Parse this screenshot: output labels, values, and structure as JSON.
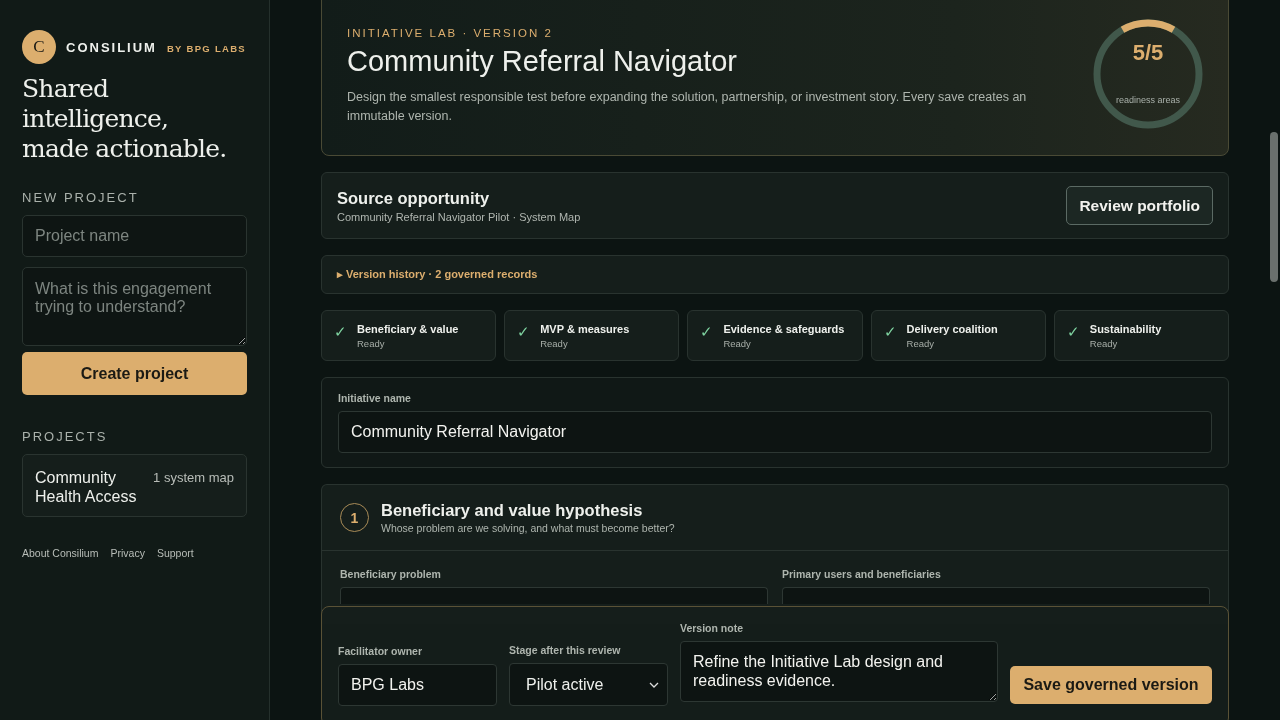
{
  "sidebar": {
    "logo_letter": "C",
    "brand": "CONSILIUM",
    "brand_sub": "BY BPG LABS",
    "tagline": "Shared intelligence, made actionable.",
    "new_project": {
      "heading": "NEW PROJECT",
      "name_placeholder": "Project name",
      "question_placeholder": "What is this engagement trying to understand?",
      "button": "Create project"
    },
    "projects_heading": "PROJECTS",
    "projects": [
      {
        "name": "Community Health Access",
        "count": "1 system map"
      }
    ],
    "footer_links": [
      "About Consilium",
      "Privacy",
      "Support"
    ]
  },
  "hero": {
    "eyebrow": "INITIATIVE LAB · VERSION 2",
    "title": "Community Referral Navigator",
    "description": "Design the smallest responsible test before expanding the solution, partnership, or investment story. Every save creates an immutable version.",
    "readiness": {
      "value": "5/5",
      "label": "readiness areas"
    }
  },
  "source": {
    "title": "Source opportunity",
    "subtitle": "Community Referral Navigator Pilot · System Map",
    "button": "Review portfolio"
  },
  "history": {
    "marker": "▸",
    "label": "Version history · 2 governed records",
    "expanded": false
  },
  "readiness_areas": [
    {
      "check": "✓",
      "name": "Beneficiary & value",
      "status": "Ready",
      "done": true
    },
    {
      "check": "✓",
      "name": "MVP & measures",
      "status": "Ready",
      "done": true
    },
    {
      "check": "✓",
      "name": "Evidence & safeguards",
      "status": "Ready",
      "done": true
    },
    {
      "check": "✓",
      "name": "Delivery coalition",
      "status": "Ready",
      "done": true
    },
    {
      "check": "✓",
      "name": "Sustainability",
      "status": "Ready",
      "done": true
    }
  ],
  "initiative": {
    "label": "Initiative name",
    "value": "Community Referral Navigator"
  },
  "section": {
    "number": "1",
    "title": "Beneficiary and value hypothesis",
    "subtitle": "Whose problem are we solving, and what must become better?",
    "fields": [
      {
        "label": "Beneficiary problem"
      },
      {
        "label": "Primary users and beneficiaries"
      }
    ]
  },
  "save_bar": {
    "owner_label": "Facilitator owner",
    "owner_value": "BPG Labs",
    "stage_label": "Stage after this review",
    "stage_value": "Pilot active",
    "note_label": "Version note",
    "note_value": "Refine the Initiative Lab design and readiness evidence.",
    "button": "Save governed version"
  }
}
